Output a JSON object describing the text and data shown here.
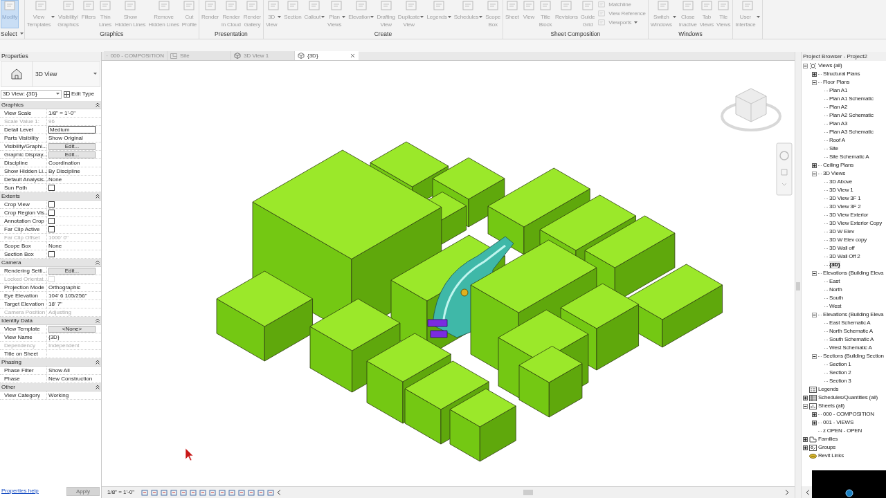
{
  "ribbon": {
    "panels": [
      {
        "title": "Select",
        "title_dropdown": true,
        "buttons": [
          {
            "kind": "large",
            "label": [
              "Modify"
            ],
            "selected": true,
            "dropdown": false
          }
        ]
      },
      {
        "title": "Graphics",
        "buttons": [
          {
            "kind": "large",
            "label": [
              "View",
              "Templates"
            ],
            "selected": false,
            "dropdown": true
          },
          {
            "kind": "large",
            "label": [
              "Visibility/",
              "Graphics"
            ],
            "selected": false,
            "dropdown": false
          },
          {
            "kind": "large",
            "label": [
              "Filters"
            ],
            "selected": false,
            "dropdown": false
          },
          {
            "kind": "large",
            "label": [
              "Thin",
              "Lines"
            ],
            "selected": false,
            "dropdown": false
          },
          {
            "kind": "large",
            "label": [
              "Show",
              "Hidden Lines"
            ],
            "selected": false,
            "dropdown": false
          },
          {
            "kind": "large",
            "label": [
              "Remove",
              "Hidden Lines"
            ],
            "selected": false,
            "dropdown": false
          },
          {
            "kind": "large",
            "label": [
              "Cut",
              "Profile"
            ],
            "selected": false,
            "dropdown": false
          }
        ]
      },
      {
        "title": "Presentation",
        "buttons": [
          {
            "kind": "large",
            "label": [
              "Render"
            ],
            "selected": false,
            "dropdown": false
          },
          {
            "kind": "large",
            "label": [
              "Render",
              "in Cloud"
            ],
            "selected": false,
            "dropdown": false
          },
          {
            "kind": "large",
            "label": [
              "Render",
              "Gallery"
            ],
            "selected": false,
            "dropdown": false
          }
        ]
      },
      {
        "title": "Create",
        "buttons": [
          {
            "kind": "large",
            "label": [
              "3D",
              "View"
            ],
            "selected": false,
            "dropdown": true
          },
          {
            "kind": "large",
            "label": [
              "Section"
            ],
            "selected": false,
            "dropdown": false
          },
          {
            "kind": "large",
            "label": [
              "Callout"
            ],
            "selected": false,
            "dropdown": true
          },
          {
            "kind": "large",
            "label": [
              "Plan",
              "Views"
            ],
            "selected": false,
            "dropdown": true
          },
          {
            "kind": "large",
            "label": [
              "Elevation"
            ],
            "selected": false,
            "dropdown": true
          },
          {
            "kind": "large",
            "label": [
              "Drafting",
              "View"
            ],
            "selected": false,
            "dropdown": false
          },
          {
            "kind": "large",
            "label": [
              "Duplicate",
              "View"
            ],
            "selected": false,
            "dropdown": true
          },
          {
            "kind": "large",
            "label": [
              "Legends"
            ],
            "selected": false,
            "dropdown": true
          },
          {
            "kind": "large",
            "label": [
              "Schedules"
            ],
            "selected": false,
            "dropdown": true
          },
          {
            "kind": "large",
            "label": [
              "Scope",
              "Box"
            ],
            "selected": false,
            "dropdown": false
          }
        ]
      },
      {
        "title": "Sheet Composition",
        "buttons": [
          {
            "kind": "large",
            "label": [
              "Sheet"
            ],
            "selected": false,
            "dropdown": false
          },
          {
            "kind": "large",
            "label": [
              "View"
            ],
            "selected": false,
            "dropdown": false
          },
          {
            "kind": "large",
            "label": [
              "Title",
              "Block"
            ],
            "selected": false,
            "dropdown": false
          },
          {
            "kind": "large",
            "label": [
              "Revisions"
            ],
            "selected": false,
            "dropdown": false
          },
          {
            "kind": "large",
            "label": [
              "Guide",
              "Grid"
            ],
            "selected": false,
            "dropdown": false
          },
          {
            "kind": "small",
            "label": [
              "Matchline"
            ],
            "selected": false,
            "dropdown": false
          },
          {
            "kind": "small",
            "label": [
              "View Reference"
            ],
            "selected": false,
            "dropdown": false
          },
          {
            "kind": "small",
            "label": [
              "Viewports"
            ],
            "selected": false,
            "dropdown": true
          }
        ]
      },
      {
        "title": "Windows",
        "buttons": [
          {
            "kind": "large",
            "label": [
              "Switch",
              "Windows"
            ],
            "selected": false,
            "dropdown": true
          },
          {
            "kind": "large",
            "label": [
              "Close",
              "Inactive"
            ],
            "selected": false,
            "dropdown": false
          },
          {
            "kind": "large",
            "label": [
              "Tab",
              "Views"
            ],
            "selected": false,
            "dropdown": false
          },
          {
            "kind": "large",
            "label": [
              "Tile",
              "Views"
            ],
            "selected": false,
            "dropdown": false
          }
        ]
      },
      {
        "buttons": [
          {
            "kind": "large",
            "label": [
              "User",
              "Interface"
            ],
            "selected": false,
            "dropdown": true
          }
        ]
      }
    ]
  },
  "properties": {
    "title": "Properties",
    "type_name": "3D View",
    "instance_selector": "3D View: {3D}",
    "edit_type": "Edit Type",
    "groups": [
      {
        "title": "Graphics",
        "rows": [
          {
            "kind": "text",
            "label": "View Scale",
            "value": "1/8\" = 1'-0\"",
            "disabled": false
          },
          {
            "kind": "text",
            "label": "Scale Value    1:",
            "value": "96",
            "disabled": true
          },
          {
            "kind": "field",
            "label": "Detail Level",
            "value": "Medium",
            "disabled": false
          },
          {
            "kind": "text",
            "label": "Parts Visibility",
            "value": "Show Original",
            "disabled": false
          },
          {
            "kind": "button",
            "label": "Visibility/Graphi...",
            "value": "Edit...",
            "disabled": false
          },
          {
            "kind": "button",
            "label": "Graphic Display...",
            "value": "Edit...",
            "disabled": false
          },
          {
            "kind": "text",
            "label": "Discipline",
            "value": "Coordination",
            "disabled": false
          },
          {
            "kind": "text",
            "label": "Show Hidden Li...",
            "value": "By Discipline",
            "disabled": false
          },
          {
            "kind": "text",
            "label": "Default Analysis...",
            "value": "None",
            "disabled": false
          },
          {
            "kind": "checkbox",
            "label": "Sun Path",
            "checked": false,
            "disabled": false
          }
        ]
      },
      {
        "title": "Extents",
        "rows": [
          {
            "kind": "checkbox",
            "label": "Crop View",
            "checked": false,
            "disabled": false
          },
          {
            "kind": "checkbox",
            "label": "Crop Region Vis...",
            "checked": false,
            "disabled": false
          },
          {
            "kind": "checkbox",
            "label": "Annotation Crop",
            "checked": false,
            "disabled": false
          },
          {
            "kind": "checkbox",
            "label": "Far Clip Active",
            "checked": false,
            "disabled": false
          },
          {
            "kind": "text",
            "label": "Far Clip Offset",
            "value": "1000'  0\"",
            "disabled": true
          },
          {
            "kind": "text",
            "label": "Scope Box",
            "value": "None",
            "disabled": false
          },
          {
            "kind": "checkbox",
            "label": "Section Box",
            "checked": false,
            "disabled": false
          }
        ]
      },
      {
        "title": "Camera",
        "rows": [
          {
            "kind": "button",
            "label": "Rendering Setti...",
            "value": "Edit...",
            "disabled": false
          },
          {
            "kind": "checkbox",
            "label": "Locked Orientat...",
            "checked": false,
            "disabled": true
          },
          {
            "kind": "text",
            "label": "Projection Mode",
            "value": "Orthographic",
            "disabled": false
          },
          {
            "kind": "text",
            "label": "Eye Elevation",
            "value": "104'  6 105/256\"",
            "disabled": false
          },
          {
            "kind": "text",
            "label": "Target Elevation",
            "value": "18'  7\"",
            "disabled": false
          },
          {
            "kind": "text",
            "label": "Camera Position",
            "value": "Adjusting",
            "disabled": true
          }
        ]
      },
      {
        "title": "Identity Data",
        "rows": [
          {
            "kind": "button",
            "label": "View Template",
            "value": "<None>",
            "disabled": false
          },
          {
            "kind": "text",
            "label": "View Name",
            "value": "{3D}",
            "disabled": false
          },
          {
            "kind": "text",
            "label": "Dependency",
            "value": "Independent",
            "disabled": true
          },
          {
            "kind": "text",
            "label": "Title on Sheet",
            "disabled": false
          }
        ]
      },
      {
        "title": "Phasing",
        "rows": [
          {
            "kind": "text",
            "label": "Phase Filter",
            "value": "Show All",
            "disabled": false
          },
          {
            "kind": "text",
            "label": "Phase",
            "value": "New Construction",
            "disabled": false
          }
        ]
      },
      {
        "title": "Other",
        "rows": [
          {
            "kind": "text",
            "label": "View Category",
            "value": "Working",
            "disabled": false
          }
        ]
      }
    ],
    "help_link": "Properties help",
    "apply_button": {
      "label": "Apply",
      "disabled": true
    }
  },
  "tabs": [
    {
      "kind": "sheet",
      "label": "000 - COMPOSITION",
      "selected": false
    },
    {
      "kind": "plan",
      "label": "Site",
      "selected": false
    },
    {
      "kind": "model",
      "label": "3D View 1",
      "selected": false
    },
    {
      "kind": "model",
      "label": "{3D}",
      "selected": true
    }
  ],
  "view_bar": {
    "scale": "1/8\" = 1'-0\""
  },
  "project_browser": {
    "title": "Project Browser - Project2",
    "tree": [
      {
        "kind": "views",
        "label": "Views (all)",
        "expanded": true,
        "selected": false,
        "children": [
          {
            "label": "Structural Plans",
            "expanded": false,
            "selected": false
          },
          {
            "label": "Floor Plans",
            "expanded": true,
            "selected": false,
            "children": [
              {
                "label": "Plan A1",
                "selected": false
              },
              {
                "label": "Plan A1 Schematic",
                "selected": false
              },
              {
                "label": "Plan A2",
                "selected": false
              },
              {
                "label": "Plan A2 Schematic",
                "selected": false
              },
              {
                "label": "Plan A3",
                "selected": false
              },
              {
                "label": "Plan A3 Schematic",
                "selected": false
              },
              {
                "label": "Roof A",
                "selected": false
              },
              {
                "label": "Site",
                "selected": false
              },
              {
                "label": "Site Schematic A",
                "selected": false
              }
            ]
          },
          {
            "label": "Ceiling Plans",
            "expanded": false,
            "selected": false
          },
          {
            "label": "3D Views",
            "expanded": true,
            "selected": false,
            "children": [
              {
                "label": "3D Above",
                "selected": false
              },
              {
                "label": "3D View 1",
                "selected": false
              },
              {
                "label": "3D View 3F 1",
                "selected": false
              },
              {
                "label": "3D View 3F 2",
                "selected": false
              },
              {
                "label": "3D View Exterior",
                "selected": false
              },
              {
                "label": "3D View Exterior Copy",
                "selected": false
              },
              {
                "label": "3D W Elev",
                "selected": false
              },
              {
                "label": "3D W Elev copy",
                "selected": false
              },
              {
                "label": "3D Wall off",
                "selected": false
              },
              {
                "label": "3D Wall Off 2",
                "selected": false
              },
              {
                "label": "{3D}",
                "selected": true
              }
            ]
          },
          {
            "label": "Elevations (Building Eleva",
            "expanded": true,
            "selected": false,
            "children": [
              {
                "label": "East",
                "selected": false
              },
              {
                "label": "North",
                "selected": false
              },
              {
                "label": "South",
                "selected": false
              },
              {
                "label": "West",
                "selected": false
              }
            ]
          },
          {
            "label": "Elevations (Building Eleva",
            "expanded": true,
            "selected": false,
            "children": [
              {
                "label": "East Schematic A",
                "selected": false
              },
              {
                "label": "North Schematic A",
                "selected": false
              },
              {
                "label": "South Schematic A",
                "selected": false
              },
              {
                "label": "West Schematic A",
                "selected": false
              }
            ]
          },
          {
            "label": "Sections (Building Section",
            "expanded": true,
            "selected": false,
            "children": [
              {
                "label": "Section 1",
                "selected": false
              },
              {
                "label": "Section 2",
                "selected": false
              },
              {
                "label": "Section 3",
                "selected": false
              }
            ]
          }
        ]
      },
      {
        "kind": "legends",
        "label": "Legends",
        "selected": false
      },
      {
        "kind": "schedules",
        "label": "Schedules/Quantities (all)",
        "expanded": false,
        "selected": false
      },
      {
        "kind": "sheets",
        "label": "Sheets (all)",
        "expanded": true,
        "selected": false,
        "children": [
          {
            "label": "000 - COMPOSITION",
            "expanded": false,
            "selected": false
          },
          {
            "label": "001 - VIEWS",
            "expanded": false,
            "selected": false
          },
          {
            "label": "z OPEN - OPEN",
            "selected": false
          }
        ]
      },
      {
        "kind": "families",
        "label": "Families",
        "expanded": false,
        "selected": false
      },
      {
        "kind": "groups",
        "label": "Groups",
        "expanded": false,
        "selected": false
      },
      {
        "kind": "links",
        "label": "Revit Links",
        "selected": false
      }
    ]
  }
}
